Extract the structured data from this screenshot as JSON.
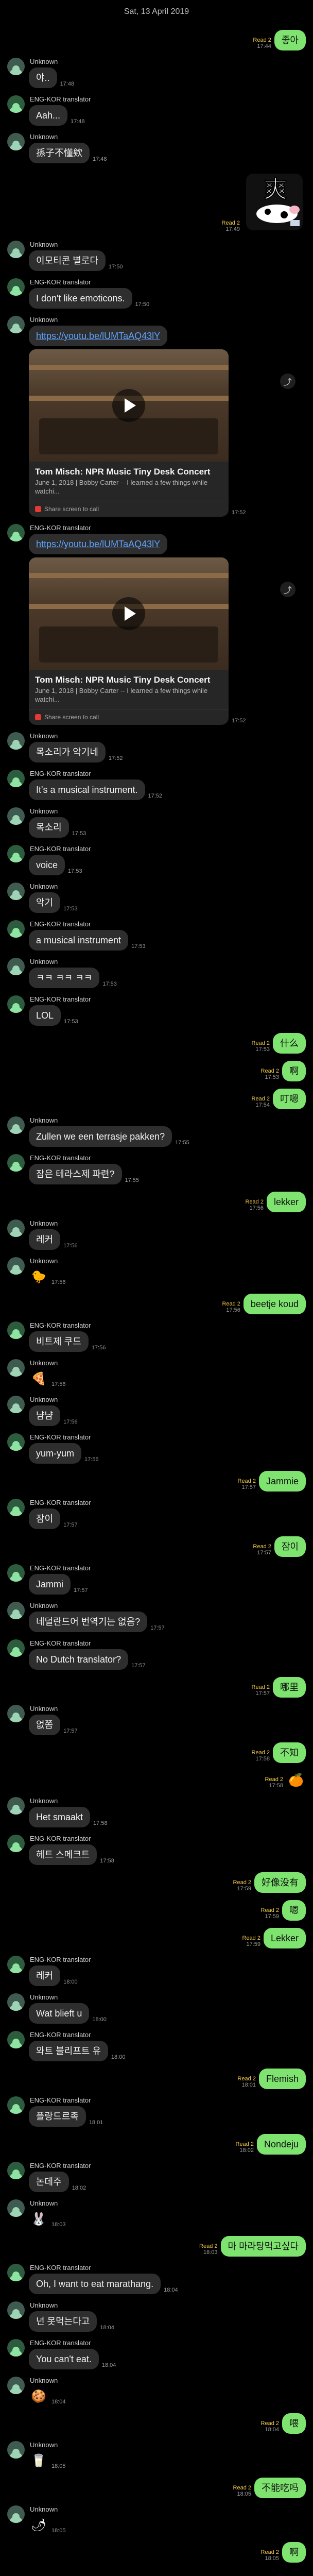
{
  "header": {
    "date": "Sat, 13 April 2019"
  },
  "senders": {
    "unknown": "Unknown",
    "bot": "ENG-KOR translator"
  },
  "card": {
    "title": "Tom Misch: NPR Music Tiny Desk Concert",
    "desc": "June 1, 2018 | Bobby Carter -- I learned a few things while watchi...",
    "footer": "Share screen to call"
  },
  "messages": [
    {
      "side": "right",
      "text": "좋아",
      "read": "Read 2",
      "time": "17:44"
    },
    {
      "side": "left",
      "who": "unknown",
      "text": "야..",
      "time": "17:48",
      "showSender": true
    },
    {
      "side": "left",
      "who": "bot",
      "text": "Aah...",
      "time": "17:48",
      "showSender": true
    },
    {
      "side": "left",
      "who": "unknown",
      "text": "孫子不懂欸",
      "time": "17:48",
      "showSender": true
    },
    {
      "side": "right",
      "kind": "emoticon",
      "read": "Read 2",
      "time": "17:49"
    },
    {
      "side": "left",
      "who": "unknown",
      "text": "이모티콘 별로다",
      "time": "17:50",
      "showSender": true
    },
    {
      "side": "left",
      "who": "bot",
      "text": "I don't like emoticons.",
      "time": "17:50",
      "showSender": true
    },
    {
      "side": "left",
      "who": "unknown",
      "kind": "link",
      "text": "https://youtu.be/lUMTaAQ43lY",
      "time": "17:52",
      "showSender": true
    },
    {
      "side": "left",
      "who": "bot",
      "kind": "link",
      "text": "https://youtu.be/lUMTaAQ43lY",
      "time": "17:52",
      "showSender": true
    },
    {
      "side": "left",
      "who": "unknown",
      "text": "목소리가 악기네",
      "time": "17:52",
      "showSender": true
    },
    {
      "side": "left",
      "who": "bot",
      "text": "It's a musical instrument.",
      "time": "17:52",
      "showSender": true
    },
    {
      "side": "left",
      "who": "unknown",
      "text": "목소리",
      "time": "17:53",
      "showSender": true
    },
    {
      "side": "left",
      "who": "bot",
      "text": "voice",
      "time": "17:53",
      "showSender": true
    },
    {
      "side": "left",
      "who": "unknown",
      "text": "악기",
      "time": "17:53",
      "showSender": true
    },
    {
      "side": "left",
      "who": "bot",
      "text": "a musical instrument",
      "time": "17:53",
      "showSender": true
    },
    {
      "side": "left",
      "who": "unknown",
      "text": "ㅋㅋ ㅋㅋ ㅋㅋ",
      "time": "17:53",
      "showSender": true
    },
    {
      "side": "left",
      "who": "bot",
      "text": "LOL",
      "time": "17:53",
      "showSender": true
    },
    {
      "side": "right",
      "text": "什么",
      "read": "Read 2",
      "time": "17:53"
    },
    {
      "side": "right",
      "text": "啊",
      "read": "Read 2",
      "time": "17:53"
    },
    {
      "side": "right",
      "text": "叮嗯",
      "read": "Read 2",
      "time": "17:54"
    },
    {
      "side": "left",
      "who": "unknown",
      "text": "Zullen we een terrasje pakken?",
      "time": "17:55",
      "showSender": true
    },
    {
      "side": "left",
      "who": "bot",
      "text": "잠은 테라스제 파련?",
      "time": "17:55",
      "showSender": true
    },
    {
      "side": "right",
      "text": "lekker",
      "read": "Read 2",
      "time": "17:56"
    },
    {
      "side": "left",
      "who": "unknown",
      "text": "레커",
      "time": "17:56",
      "showSender": true
    },
    {
      "side": "left",
      "who": "unknown",
      "kind": "sticker",
      "text": "🐤",
      "time": "17:56",
      "showSender": true
    },
    {
      "side": "right",
      "text": "beetje koud",
      "read": "Read 2",
      "time": "17:56"
    },
    {
      "side": "left",
      "who": "bot",
      "text": "비트제 쿠드",
      "time": "17:56",
      "showSender": true
    },
    {
      "side": "left",
      "who": "unknown",
      "kind": "sticker",
      "text": "🍕",
      "time": "17:56",
      "showSender": true
    },
    {
      "side": "left",
      "who": "unknown",
      "text": "냠냠",
      "time": "17:56",
      "showSender": true
    },
    {
      "side": "left",
      "who": "bot",
      "text": "yum-yum",
      "time": "17:56",
      "showSender": true
    },
    {
      "side": "right",
      "text": "Jammie",
      "read": "Read 2",
      "time": "17:57"
    },
    {
      "side": "left",
      "who": "bot",
      "text": "잠이",
      "time": "17:57",
      "showSender": true
    },
    {
      "side": "right",
      "text": "잠이",
      "read": "Read 2",
      "time": "17:57"
    },
    {
      "side": "left",
      "who": "bot",
      "text": "Jammi",
      "time": "17:57",
      "showSender": true
    },
    {
      "side": "left",
      "who": "unknown",
      "text": "네덜란드어 번역기는 없음?",
      "time": "17:57",
      "showSender": true
    },
    {
      "side": "left",
      "who": "bot",
      "text": "No Dutch translator?",
      "time": "17:57",
      "showSender": true
    },
    {
      "side": "right",
      "text": "哪里",
      "read": "Read 2",
      "time": "17:57"
    },
    {
      "side": "left",
      "who": "unknown",
      "text": "없쫌",
      "time": "17:57",
      "showSender": true
    },
    {
      "side": "right",
      "text": "不知",
      "read": "Read 2",
      "time": "17:58"
    },
    {
      "side": "right",
      "kind": "sticker",
      "text": "🍊",
      "read": "Read 2",
      "time": "17:58"
    },
    {
      "side": "left",
      "who": "unknown",
      "text": "Het smaakt",
      "time": "17:58",
      "showSender": true
    },
    {
      "side": "left",
      "who": "bot",
      "text": "헤트 스메크트",
      "time": "17:58",
      "showSender": true
    },
    {
      "side": "right",
      "text": "好像没有",
      "read": "Read 2",
      "time": "17:59"
    },
    {
      "side": "right",
      "text": "嗯",
      "read": "Read 2",
      "time": "17:59"
    },
    {
      "side": "right",
      "text": "Lekker",
      "read": "Read 2",
      "time": "17:59"
    },
    {
      "side": "left",
      "who": "bot",
      "text": "레커",
      "time": "18:00",
      "showSender": true
    },
    {
      "side": "left",
      "who": "unknown",
      "text": "Wat blieft u",
      "time": "18:00",
      "showSender": true
    },
    {
      "side": "left",
      "who": "bot",
      "text": "와트 블리프트 유",
      "time": "18:00",
      "showSender": true
    },
    {
      "side": "right",
      "text": "Flemish",
      "read": "Read 2",
      "time": "18:01"
    },
    {
      "side": "left",
      "who": "bot",
      "text": "플랑드르족",
      "time": "18:01",
      "showSender": true
    },
    {
      "side": "right",
      "text": "Nondeju",
      "read": "Read 2",
      "time": "18:02"
    },
    {
      "side": "left",
      "who": "bot",
      "text": "논데주",
      "time": "18:02",
      "showSender": true
    },
    {
      "side": "left",
      "who": "unknown",
      "kind": "sticker",
      "text": "🐰",
      "time": "18:03",
      "showSender": true
    },
    {
      "side": "right",
      "text": "마 마라탕먹고싶다",
      "read": "Read 2",
      "time": "18:03"
    },
    {
      "side": "left",
      "who": "bot",
      "text": "Oh, I want to eat marathang.",
      "time": "18:04",
      "showSender": true
    },
    {
      "side": "left",
      "who": "unknown",
      "text": "넌 못먹는다고",
      "time": "18:04",
      "showSender": true
    },
    {
      "side": "left",
      "who": "bot",
      "text": "You can't eat.",
      "time": "18:04",
      "showSender": true
    },
    {
      "side": "left",
      "who": "unknown",
      "kind": "sticker",
      "text": "🍪",
      "time": "18:04",
      "showSender": true
    },
    {
      "side": "right",
      "text": "喂",
      "read": "Read 2",
      "time": "18:04"
    },
    {
      "side": "left",
      "who": "unknown",
      "kind": "sticker",
      "text": "🥛",
      "time": "18:05",
      "showSender": true
    },
    {
      "side": "right",
      "text": "不能吃吗",
      "read": "Read 2",
      "time": "18:05"
    },
    {
      "side": "left",
      "who": "unknown",
      "kind": "sticker",
      "text": "🌶",
      "time": "18:05",
      "showSender": true
    },
    {
      "side": "right",
      "text": "啊",
      "read": "Read 2",
      "time": "18:05"
    }
  ]
}
